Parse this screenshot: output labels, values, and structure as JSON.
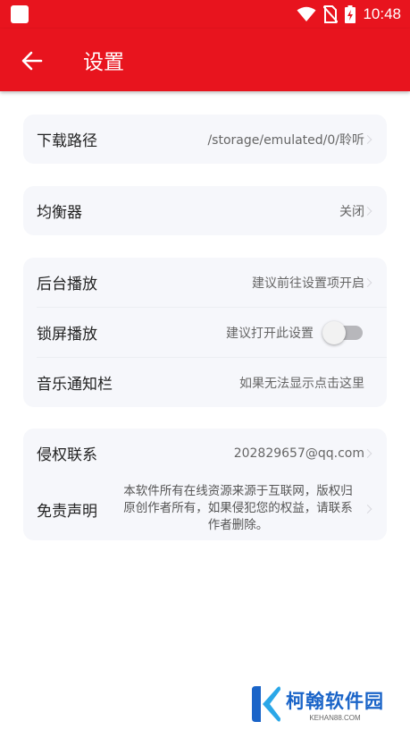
{
  "status_bar": {
    "time": "10:48",
    "icons": [
      "app-square-icon",
      "wifi-icon",
      "no-sim-icon",
      "battery-charging-icon"
    ]
  },
  "toolbar": {
    "back_icon": "arrow-left-icon",
    "title": "设置"
  },
  "download": {
    "label": "下载路径",
    "value": "/storage/emulated/0/聆听"
  },
  "equalizer": {
    "label": "均衡器",
    "value": "关闭"
  },
  "playback": {
    "background_label": "后台播放",
    "background_value": "建议前往设置项开启",
    "lockscreen_label": "锁屏播放",
    "lockscreen_value": "建议打开此设置",
    "lockscreen_enabled": false,
    "notification_label": "音乐通知栏",
    "notification_value": "如果无法显示点击这里"
  },
  "about": {
    "contact_label": "侵权联系",
    "contact_value": "202829657@qq.com",
    "disclaimer_label": "免责声明",
    "disclaimer_text": "本软件所有在线资源来源于互联网，版权归原创作者所有，如果侵犯您的权益，请联系作者删除。"
  },
  "watermark": {
    "name": "柯翰软件园",
    "url": "KEHAN88.COM"
  },
  "colors": {
    "accent": "#e8141e",
    "card_bg": "#f6f7fb",
    "watermark": "#1a64c8"
  }
}
